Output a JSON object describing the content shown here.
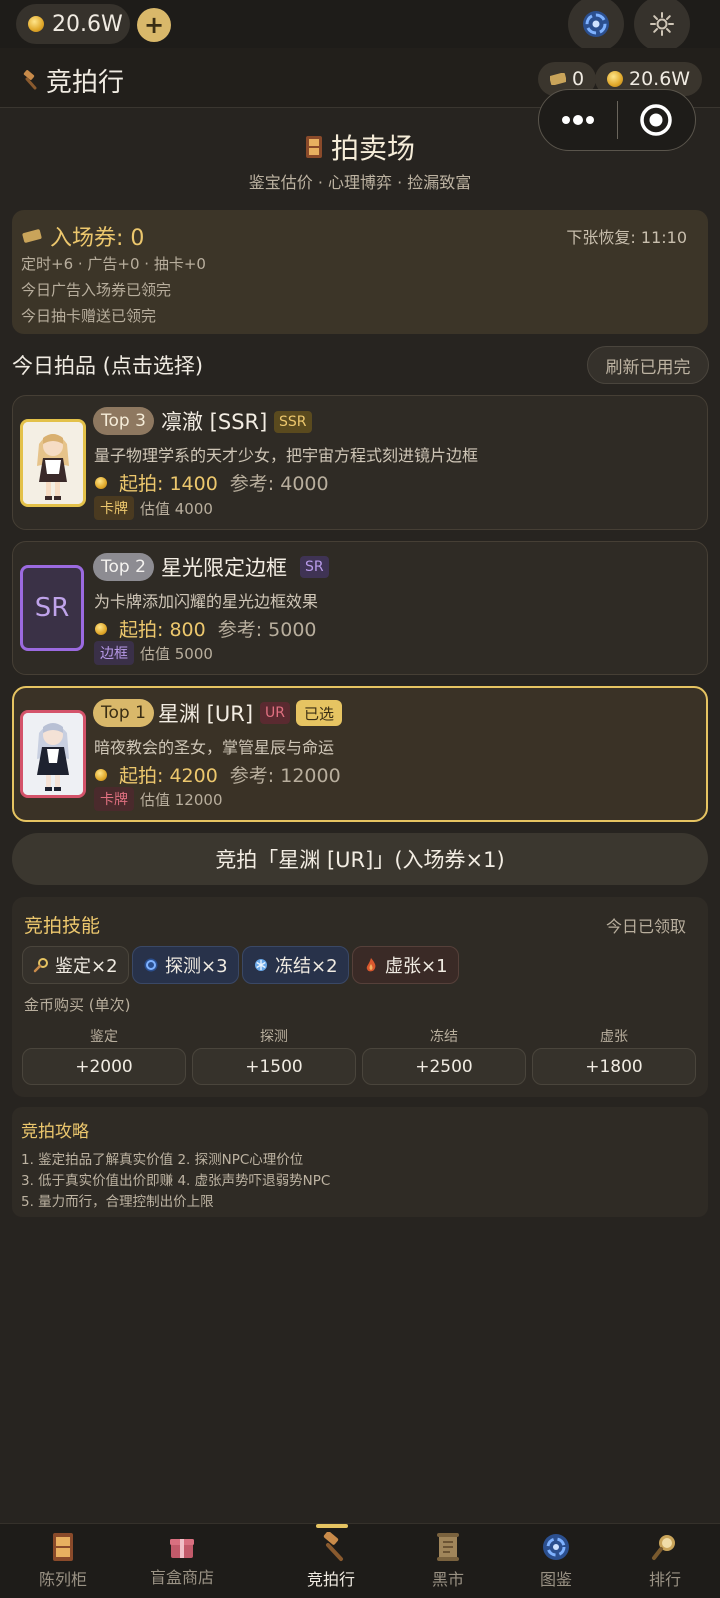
{
  "topbar": {
    "coins": "20.6W",
    "add_label": "+"
  },
  "header": {
    "title": "竞拍行",
    "tickets": "0",
    "coins": "20.6W"
  },
  "hero": {
    "title": "拍卖场",
    "subtitle": "鉴宝估价 · 心理博弈 · 捡漏致富"
  },
  "ticket": {
    "title": "入场券: 0",
    "recover": "下张恢复: 11:10",
    "lines": [
      "定时+6 · 广告+0 · 抽卡+0",
      "今日广告入场券已领完",
      "今日抽卡赠送已领完"
    ]
  },
  "items_section": {
    "title": "今日拍品 (点击选择)",
    "refresh_label": "刷新已用完"
  },
  "items": [
    {
      "rank": "Top 3",
      "name": "凛澈 [SSR]",
      "rarity": "SSR",
      "desc": "量子物理学系的天才少女，把宇宙方程式刻进镜片边框",
      "start": "起拍: 1400",
      "ref": "参考: 4000",
      "tag": "卡牌",
      "est": "估值 4000",
      "selected_label": ""
    },
    {
      "rank": "Top 2",
      "name": "星光限定边框",
      "rarity": "SR",
      "thumb_text": "SR",
      "desc": "为卡牌添加闪耀的星光边框效果",
      "start": "起拍: 800",
      "ref": "参考: 5000",
      "tag": "边框",
      "est": "估值 5000",
      "selected_label": ""
    },
    {
      "rank": "Top 1",
      "name": "星渊 [UR]",
      "rarity": "UR",
      "desc": "暗夜教会的圣女，掌管星辰与命运",
      "start": "起拍: 4200",
      "ref": "参考: 12000",
      "tag": "卡牌",
      "est": "估值 12000",
      "selected_label": "已选"
    }
  ],
  "bid_button": "竞拍「星渊 [UR]」(入场券×1)",
  "skills": {
    "title": "竞拍技能",
    "status": "今日已领取",
    "chips": [
      {
        "label": "鉴定×2",
        "icon": "magnifier-icon"
      },
      {
        "label": "探测×3",
        "icon": "radar-icon"
      },
      {
        "label": "冻结×2",
        "icon": "snowflake-icon"
      },
      {
        "label": "虚张×1",
        "icon": "flame-icon"
      }
    ],
    "buy_title": "金币购买 (单次)",
    "buy": [
      {
        "label": "鉴定",
        "amount": "+2000"
      },
      {
        "label": "探测",
        "amount": "+1500"
      },
      {
        "label": "冻结",
        "amount": "+2500"
      },
      {
        "label": "虚张",
        "amount": "+1800"
      }
    ]
  },
  "tips": {
    "title": "竞拍攻略",
    "lines": [
      "1. 鉴定拍品了解真实价值  2. 探测NPC心理价位",
      "3. 低于真实价值出价即赚  4. 虚张声势吓退弱势NPC",
      "5. 量力而行，合理控制出价上限"
    ]
  },
  "nav": [
    {
      "label": "陈列柜"
    },
    {
      "label": "盲盒商店"
    },
    {
      "label": "竞拍行"
    },
    {
      "label": "黑市"
    },
    {
      "label": "图鉴"
    },
    {
      "label": "排行"
    }
  ],
  "colors": {
    "background": "#272420",
    "gold": "#ecc76d",
    "selected_border": "#e6c462",
    "ssr_border": "#e3c149",
    "sr_border": "#9b6ae0",
    "ur_border": "#d4536a"
  }
}
